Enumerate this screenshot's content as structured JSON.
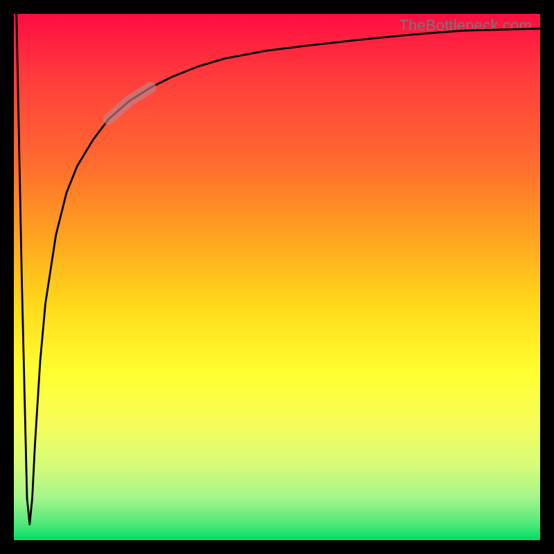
{
  "watermark": "TheBottleneck.com",
  "chart_data": {
    "type": "line",
    "title": "",
    "xlabel": "",
    "ylabel": "",
    "xlim": [
      0,
      100
    ],
    "ylim": [
      0,
      100
    ],
    "grid": false,
    "legend": false,
    "annotations": [],
    "series": [
      {
        "name": "bottleneck-curve",
        "x": [
          0.5,
          1.5,
          2.5,
          3.0,
          3.5,
          4.0,
          5.0,
          6.0,
          8.0,
          10.0,
          12.0,
          15.0,
          18.0,
          22.0,
          26.0,
          30.0,
          35.0,
          40.0,
          48.0,
          56.0,
          65.0,
          75.0,
          85.0,
          100.0
        ],
        "y": [
          100,
          50,
          8,
          3,
          8,
          18,
          34,
          45,
          58,
          66,
          71,
          76,
          80,
          83.5,
          86,
          88,
          90,
          91.5,
          93,
          94,
          95,
          96,
          96.8,
          97.2
        ]
      }
    ],
    "highlight_segment": {
      "series": "bottleneck-curve",
      "x_range": [
        18,
        26
      ],
      "style": "thick-pale"
    },
    "background_gradient": {
      "orientation": "vertical",
      "stops": [
        {
          "pos": 0.0,
          "color": "#ff0c42"
        },
        {
          "pos": 0.28,
          "color": "#ff6a2f"
        },
        {
          "pos": 0.55,
          "color": "#ffd81a"
        },
        {
          "pos": 0.78,
          "color": "#f6fd5a"
        },
        {
          "pos": 1.0,
          "color": "#00dd66"
        }
      ]
    }
  }
}
